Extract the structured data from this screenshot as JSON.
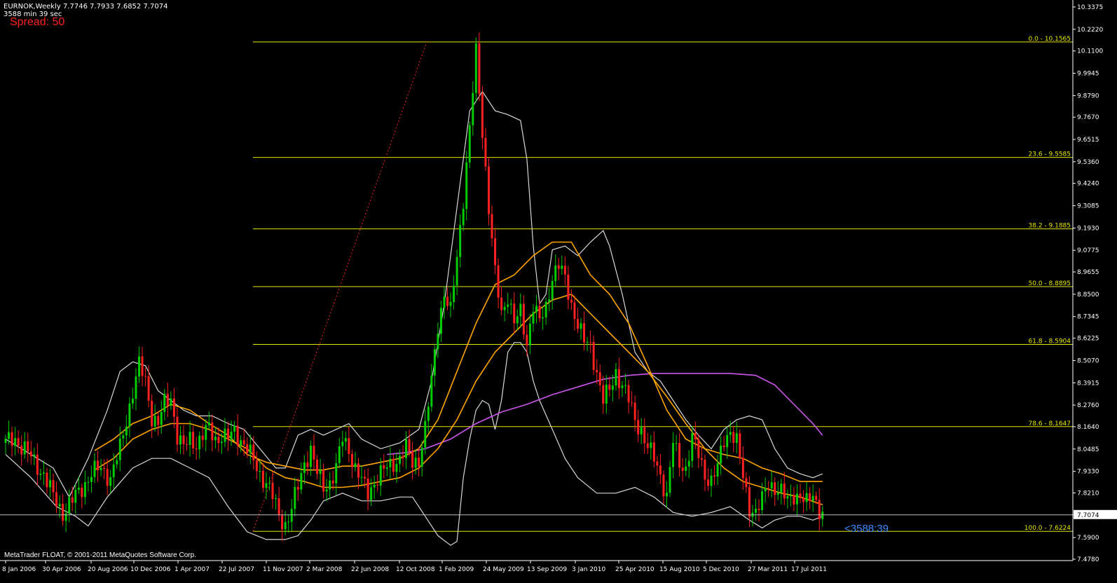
{
  "header": {
    "symbol_line": "EURNOK,Weekly  7.7746 7.7933 7.6852 7.7074",
    "timer_line": "3588 min 39 sec",
    "spread": "Spread: 50"
  },
  "countdown": "<3588:39",
  "footer": "MetaTrader FLOAT, © 2001-2011 MetaQuotes Software Corp.",
  "colors": {
    "background": "#000000",
    "bull_candle": "#00cc00",
    "bear_candle": "#ff2020",
    "fib_line": "#e6e600",
    "bands": "#d8d8d8",
    "ma_orange": "#ffa500",
    "ma_purple": "#cc55ee",
    "fib_trend": "#ff2020",
    "price_line": "#c0c0c0"
  },
  "chart_data": {
    "type": "candlestick",
    "symbol": "EURNOK",
    "timeframe": "Weekly",
    "current_price": 7.7074,
    "ylim": [
      7.4,
      10.4
    ],
    "y_ticks": [
      "10.3375",
      "10.2220",
      "10.1100",
      "9.9945",
      "9.8790",
      "9.7670",
      "9.6515",
      "9.5360",
      "9.4240",
      "9.3085",
      "9.1930",
      "9.0775",
      "8.9655",
      "8.8500",
      "8.7345",
      "8.6225",
      "8.5070",
      "8.3915",
      "8.2760",
      "8.1640",
      "8.0485",
      "7.9330",
      "7.8210",
      "7.7074",
      "7.5900",
      "7.4780"
    ],
    "x_ticks": [
      "8 Jan 2006",
      "30 Apr 2006",
      "20 Aug 2006",
      "10 Dec 2006",
      "1 Apr 2007",
      "22 Jul 2007",
      "11 Nov 2007",
      "2 Mar 2008",
      "22 Jun 2008",
      "12 Oct 2008",
      "1 Feb 2009",
      "24 May 2009",
      "13 Sep 2009",
      "3 Jan 2010",
      "25 Apr 2010",
      "15 Aug 2010",
      "5 Dec 2010",
      "27 Mar 2011",
      "17 Jul 2011"
    ],
    "fibonacci": [
      {
        "label": "0.0 - 10.1565",
        "value": 10.1565
      },
      {
        "label": "23.6 - 9.5585",
        "value": 9.5585
      },
      {
        "label": "38.2 - 9.1885",
        "value": 9.1885
      },
      {
        "label": "50.0 - 8.8895",
        "value": 8.8895
      },
      {
        "label": "61.8 - 8.5904",
        "value": 8.5904
      },
      {
        "label": "78.6 - 8.1647",
        "value": 8.1647
      },
      {
        "label": "100.0 - 7.6224",
        "value": 7.6224
      }
    ],
    "close_path": [
      [
        0,
        8.08
      ],
      [
        3,
        8.1
      ],
      [
        6,
        8.05
      ],
      [
        9,
        7.98
      ],
      [
        12,
        7.92
      ],
      [
        15,
        7.8
      ],
      [
        18,
        7.72
      ],
      [
        21,
        7.78
      ],
      [
        24,
        7.85
      ],
      [
        27,
        7.92
      ],
      [
        30,
        7.95
      ],
      [
        33,
        7.9
      ],
      [
        36,
        8.05
      ],
      [
        38,
        8.2
      ],
      [
        40,
        8.35
      ],
      [
        42,
        8.48
      ],
      [
        44,
        8.4
      ],
      [
        46,
        8.22
      ],
      [
        48,
        8.18
      ],
      [
        50,
        8.28
      ],
      [
        52,
        8.32
      ],
      [
        54,
        8.12
      ],
      [
        56,
        8.05
      ],
      [
        58,
        8.1
      ],
      [
        60,
        8.08
      ],
      [
        62,
        8.12
      ],
      [
        64,
        8.15
      ],
      [
        66,
        8.1
      ],
      [
        68,
        8.12
      ],
      [
        70,
        8.1
      ],
      [
        72,
        8.14
      ],
      [
        74,
        8.1
      ],
      [
        76,
        8.05
      ],
      [
        78,
        7.98
      ],
      [
        80,
        7.92
      ],
      [
        82,
        7.88
      ],
      [
        84,
        7.8
      ],
      [
        86,
        7.7
      ],
      [
        88,
        7.66
      ],
      [
        90,
        7.74
      ],
      [
        92,
        7.85
      ],
      [
        94,
        7.98
      ],
      [
        96,
        8.05
      ],
      [
        98,
        7.92
      ],
      [
        100,
        7.85
      ],
      [
        102,
        7.88
      ],
      [
        104,
        7.95
      ],
      [
        106,
        8.1
      ],
      [
        108,
        8.05
      ],
      [
        110,
        7.95
      ],
      [
        112,
        7.88
      ],
      [
        114,
        7.82
      ],
      [
        116,
        7.88
      ],
      [
        118,
        7.92
      ],
      [
        120,
        7.95
      ],
      [
        122,
        7.98
      ],
      [
        124,
        8.0
      ],
      [
        126,
        8.05
      ],
      [
        128,
        7.98
      ],
      [
        130,
        8.0
      ],
      [
        132,
        8.15
      ],
      [
        134,
        8.4
      ],
      [
        136,
        8.7
      ],
      [
        138,
        8.85
      ],
      [
        140,
        8.75
      ],
      [
        142,
        9.05
      ],
      [
        144,
        9.35
      ],
      [
        146,
        9.7
      ],
      [
        148,
        10.1
      ],
      [
        150,
        9.7
      ],
      [
        152,
        9.3
      ],
      [
        154,
        8.95
      ],
      [
        156,
        8.75
      ],
      [
        158,
        8.85
      ],
      [
        160,
        8.7
      ],
      [
        162,
        8.75
      ],
      [
        164,
        8.6
      ],
      [
        166,
        8.8
      ],
      [
        168,
        8.7
      ],
      [
        170,
        8.78
      ],
      [
        172,
        8.95
      ],
      [
        174,
        9.0
      ],
      [
        176,
        8.92
      ],
      [
        178,
        8.8
      ],
      [
        180,
        8.7
      ],
      [
        182,
        8.6
      ],
      [
        184,
        8.58
      ],
      [
        186,
        8.45
      ],
      [
        188,
        8.3
      ],
      [
        190,
        8.35
      ],
      [
        192,
        8.45
      ],
      [
        194,
        8.38
      ],
      [
        196,
        8.3
      ],
      [
        198,
        8.2
      ],
      [
        200,
        8.15
      ],
      [
        202,
        8.05
      ],
      [
        204,
        8.0
      ],
      [
        206,
        7.92
      ],
      [
        208,
        7.8
      ],
      [
        210,
        8.08
      ],
      [
        212,
        7.98
      ],
      [
        214,
        7.95
      ],
      [
        216,
        8.1
      ],
      [
        218,
        8.02
      ],
      [
        220,
        7.92
      ],
      [
        222,
        7.88
      ],
      [
        224,
        7.95
      ],
      [
        226,
        8.1
      ],
      [
        228,
        8.15
      ],
      [
        230,
        8.08
      ],
      [
        232,
        7.9
      ],
      [
        234,
        7.75
      ],
      [
        236,
        7.72
      ],
      [
        238,
        7.78
      ],
      [
        240,
        7.88
      ],
      [
        242,
        7.85
      ],
      [
        244,
        7.82
      ],
      [
        246,
        7.78
      ],
      [
        248,
        7.82
      ],
      [
        250,
        7.8
      ],
      [
        252,
        7.76
      ],
      [
        254,
        7.82
      ],
      [
        256,
        7.74
      ],
      [
        257,
        7.71
      ]
    ],
    "bb_upper": [
      [
        0,
        8.1
      ],
      [
        5,
        8.05
      ],
      [
        10,
        8.0
      ],
      [
        15,
        7.95
      ],
      [
        20,
        7.8
      ],
      [
        26,
        8.0
      ],
      [
        32,
        8.25
      ],
      [
        36,
        8.45
      ],
      [
        40,
        8.5
      ],
      [
        44,
        8.48
      ],
      [
        48,
        8.35
      ],
      [
        52,
        8.3
      ],
      [
        56,
        8.25
      ],
      [
        60,
        8.22
      ],
      [
        65,
        8.22
      ],
      [
        70,
        8.18
      ],
      [
        75,
        8.15
      ],
      [
        80,
        8.05
      ],
      [
        85,
        7.95
      ],
      [
        88,
        7.95
      ],
      [
        92,
        8.12
      ],
      [
        96,
        8.15
      ],
      [
        100,
        8.12
      ],
      [
        104,
        8.15
      ],
      [
        108,
        8.18
      ],
      [
        112,
        8.1
      ],
      [
        118,
        8.05
      ],
      [
        124,
        8.08
      ],
      [
        130,
        8.15
      ],
      [
        134,
        8.4
      ],
      [
        138,
        8.8
      ],
      [
        142,
        9.3
      ],
      [
        146,
        9.8
      ],
      [
        150,
        9.9
      ],
      [
        154,
        9.8
      ],
      [
        158,
        9.78
      ],
      [
        162,
        9.75
      ],
      [
        164,
        9.55
      ],
      [
        166,
        9.1
      ],
      [
        168,
        8.8
      ],
      [
        170,
        8.85
      ],
      [
        172,
        9.08
      ],
      [
        176,
        9.1
      ],
      [
        180,
        9.05
      ],
      [
        184,
        9.12
      ],
      [
        188,
        9.18
      ],
      [
        190,
        9.1
      ],
      [
        194,
        8.85
      ],
      [
        198,
        8.55
      ],
      [
        202,
        8.45
      ],
      [
        206,
        8.4
      ],
      [
        210,
        8.3
      ],
      [
        214,
        8.2
      ],
      [
        218,
        8.12
      ],
      [
        222,
        8.05
      ],
      [
        226,
        8.15
      ],
      [
        230,
        8.2
      ],
      [
        234,
        8.22
      ],
      [
        238,
        8.2
      ],
      [
        242,
        8.05
      ],
      [
        246,
        7.95
      ],
      [
        250,
        7.92
      ],
      [
        254,
        7.9
      ],
      [
        257,
        7.92
      ]
    ],
    "bb_lower": [
      [
        0,
        8.02
      ],
      [
        8,
        7.9
      ],
      [
        16,
        7.75
      ],
      [
        22,
        7.7
      ],
      [
        26,
        7.65
      ],
      [
        32,
        7.8
      ],
      [
        40,
        7.95
      ],
      [
        46,
        8.0
      ],
      [
        52,
        8.0
      ],
      [
        58,
        7.95
      ],
      [
        64,
        7.9
      ],
      [
        70,
        7.75
      ],
      [
        76,
        7.62
      ],
      [
        82,
        7.58
      ],
      [
        88,
        7.58
      ],
      [
        92,
        7.6
      ],
      [
        96,
        7.68
      ],
      [
        100,
        7.78
      ],
      [
        106,
        7.82
      ],
      [
        112,
        7.78
      ],
      [
        118,
        7.78
      ],
      [
        124,
        7.8
      ],
      [
        128,
        7.8
      ],
      [
        132,
        7.7
      ],
      [
        136,
        7.6
      ],
      [
        140,
        7.55
      ],
      [
        142,
        7.57
      ],
      [
        144,
        7.9
      ],
      [
        146,
        8.1
      ],
      [
        148,
        8.25
      ],
      [
        150,
        8.3
      ],
      [
        152,
        8.28
      ],
      [
        154,
        8.15
      ],
      [
        156,
        8.3
      ],
      [
        158,
        8.55
      ],
      [
        160,
        8.6
      ],
      [
        162,
        8.6
      ],
      [
        164,
        8.55
      ],
      [
        166,
        8.4
      ],
      [
        168,
        8.3
      ],
      [
        172,
        8.15
      ],
      [
        176,
        8.0
      ],
      [
        180,
        7.9
      ],
      [
        186,
        7.82
      ],
      [
        192,
        7.82
      ],
      [
        198,
        7.85
      ],
      [
        204,
        7.8
      ],
      [
        210,
        7.72
      ],
      [
        216,
        7.7
      ],
      [
        222,
        7.72
      ],
      [
        228,
        7.75
      ],
      [
        234,
        7.68
      ],
      [
        238,
        7.64
      ],
      [
        242,
        7.68
      ],
      [
        246,
        7.7
      ],
      [
        250,
        7.7
      ],
      [
        254,
        7.68
      ],
      [
        257,
        7.7
      ]
    ],
    "ma_fast": [
      [
        28,
        8.04
      ],
      [
        34,
        8.1
      ],
      [
        40,
        8.18
      ],
      [
        46,
        8.22
      ],
      [
        52,
        8.28
      ],
      [
        58,
        8.25
      ],
      [
        64,
        8.18
      ],
      [
        70,
        8.12
      ],
      [
        76,
        8.02
      ],
      [
        82,
        7.98
      ],
      [
        88,
        7.96
      ],
      [
        94,
        7.94
      ],
      [
        100,
        7.94
      ],
      [
        106,
        7.96
      ],
      [
        112,
        7.96
      ],
      [
        118,
        7.98
      ],
      [
        124,
        8.0
      ],
      [
        130,
        8.05
      ],
      [
        136,
        8.2
      ],
      [
        142,
        8.45
      ],
      [
        148,
        8.7
      ],
      [
        154,
        8.9
      ],
      [
        160,
        8.95
      ],
      [
        166,
        9.05
      ],
      [
        172,
        9.12
      ],
      [
        178,
        9.12
      ],
      [
        184,
        8.95
      ],
      [
        190,
        8.85
      ],
      [
        196,
        8.7
      ],
      [
        202,
        8.48
      ],
      [
        208,
        8.25
      ],
      [
        214,
        8.1
      ],
      [
        220,
        8.05
      ],
      [
        226,
        8.02
      ],
      [
        232,
        8.0
      ],
      [
        238,
        7.95
      ],
      [
        244,
        7.92
      ],
      [
        250,
        7.88
      ],
      [
        257,
        7.88
      ]
    ],
    "ma_slow": [
      [
        28,
        7.94
      ],
      [
        34,
        8.0
      ],
      [
        40,
        8.1
      ],
      [
        46,
        8.15
      ],
      [
        52,
        8.18
      ],
      [
        58,
        8.18
      ],
      [
        64,
        8.15
      ],
      [
        70,
        8.1
      ],
      [
        76,
        8.05
      ],
      [
        82,
        7.95
      ],
      [
        88,
        7.9
      ],
      [
        94,
        7.88
      ],
      [
        100,
        7.85
      ],
      [
        106,
        7.85
      ],
      [
        112,
        7.86
      ],
      [
        118,
        7.88
      ],
      [
        124,
        7.9
      ],
      [
        130,
        7.95
      ],
      [
        136,
        8.05
      ],
      [
        142,
        8.2
      ],
      [
        148,
        8.4
      ],
      [
        154,
        8.55
      ],
      [
        160,
        8.65
      ],
      [
        166,
        8.75
      ],
      [
        172,
        8.82
      ],
      [
        178,
        8.85
      ],
      [
        184,
        8.75
      ],
      [
        190,
        8.65
      ],
      [
        196,
        8.55
      ],
      [
        202,
        8.45
      ],
      [
        208,
        8.32
      ],
      [
        214,
        8.18
      ],
      [
        220,
        8.05
      ],
      [
        226,
        7.95
      ],
      [
        232,
        7.88
      ],
      [
        238,
        7.85
      ],
      [
        244,
        7.82
      ],
      [
        250,
        7.8
      ],
      [
        257,
        7.76
      ]
    ],
    "ma_long": [
      [
        120,
        8.02
      ],
      [
        126,
        8.03
      ],
      [
        132,
        8.05
      ],
      [
        140,
        8.1
      ],
      [
        148,
        8.18
      ],
      [
        156,
        8.24
      ],
      [
        164,
        8.28
      ],
      [
        172,
        8.33
      ],
      [
        180,
        8.37
      ],
      [
        188,
        8.41
      ],
      [
        196,
        8.43
      ],
      [
        204,
        8.44
      ],
      [
        212,
        8.44
      ],
      [
        220,
        8.44
      ],
      [
        228,
        8.44
      ],
      [
        236,
        8.43
      ],
      [
        242,
        8.38
      ],
      [
        248,
        8.28
      ],
      [
        254,
        8.18
      ],
      [
        257,
        8.12
      ]
    ]
  }
}
